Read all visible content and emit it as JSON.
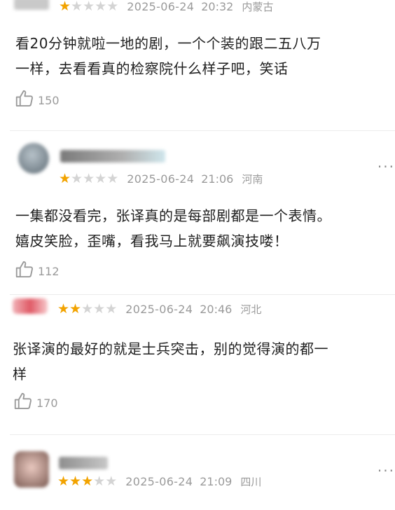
{
  "reviews": [
    {
      "rating": 1,
      "stars_total": 5,
      "date": "2025-06-24",
      "time": "20:32",
      "region": "内蒙古",
      "text": "看20分钟就啦一地的剧，一个个装的跟二五八万\n一样，去看看真的检察院什么样子吧，笑话",
      "likes": "150"
    },
    {
      "rating": 1,
      "stars_total": 5,
      "date": "2025-06-24",
      "time": "21:06",
      "region": "河南",
      "text": "一集都没看完，张译真的是每部剧都是一个表情。\n嬉皮笑脸，歪嘴，看我马上就要飙演技喽！",
      "likes": "112"
    },
    {
      "rating": 2,
      "stars_total": 5,
      "date": "2025-06-24",
      "time": "20:46",
      "region": "河北",
      "text": "张译演的最好的就是士兵突击，别的觉得演的都一\n样",
      "likes": "170"
    },
    {
      "rating": 3,
      "stars_total": 5,
      "date": "2025-06-24",
      "time": "21:09",
      "region": "四川"
    }
  ],
  "more_glyph": "···",
  "star_glyph": "★",
  "colors": {
    "star_on": "#f2a300",
    "star_off": "#d4d4d4",
    "meta_text": "#9a9a9a"
  },
  "icons": {
    "like": "thumbs-up-icon",
    "more": "more-dots-icon"
  }
}
